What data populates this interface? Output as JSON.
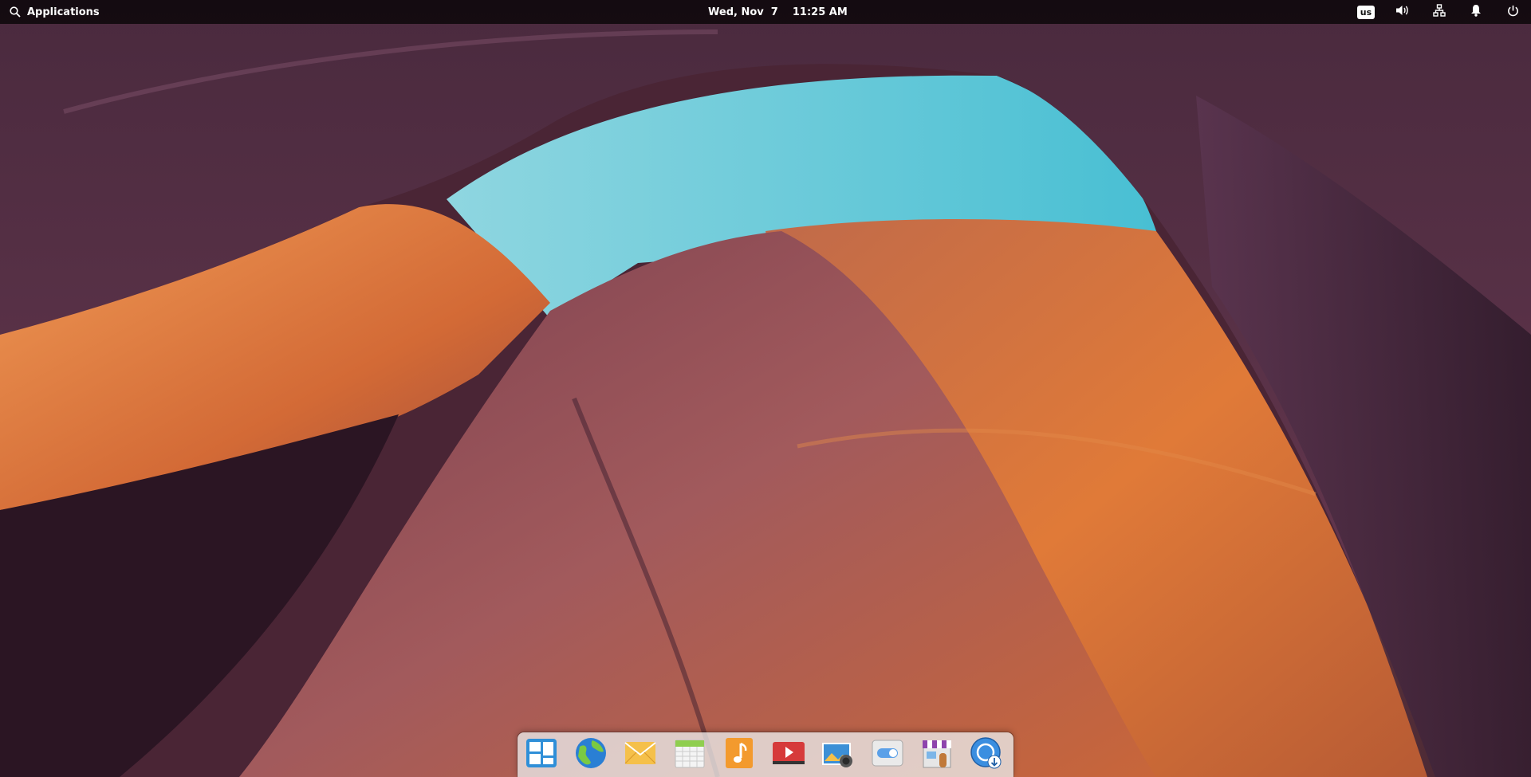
{
  "panel": {
    "applications_label": "Applications",
    "date": "Wed, Nov  7",
    "time": "11:25 AM",
    "keyboard_layout": "us",
    "icons": {
      "search": "search-icon",
      "volume": "volume-icon",
      "network": "network-icon",
      "notifications": "bell-icon",
      "power": "power-icon"
    }
  },
  "dock": {
    "apps": [
      {
        "name": "multitasking-view",
        "icon": "multitasking-icon"
      },
      {
        "name": "web-browser",
        "icon": "globe-icon"
      },
      {
        "name": "mail",
        "icon": "mail-icon"
      },
      {
        "name": "calendar",
        "icon": "calendar-icon"
      },
      {
        "name": "music",
        "icon": "music-icon"
      },
      {
        "name": "videos",
        "icon": "video-icon"
      },
      {
        "name": "photos",
        "icon": "photos-icon"
      },
      {
        "name": "system-settings",
        "icon": "settings-toggle-icon"
      },
      {
        "name": "app-center",
        "icon": "store-icon"
      },
      {
        "name": "installer",
        "icon": "installer-icon"
      }
    ]
  },
  "colors": {
    "sky": "#5ec3d6",
    "rock_orange": "#d8743a",
    "rock_purple": "#5a2f48",
    "panel_bg": "#000000"
  }
}
